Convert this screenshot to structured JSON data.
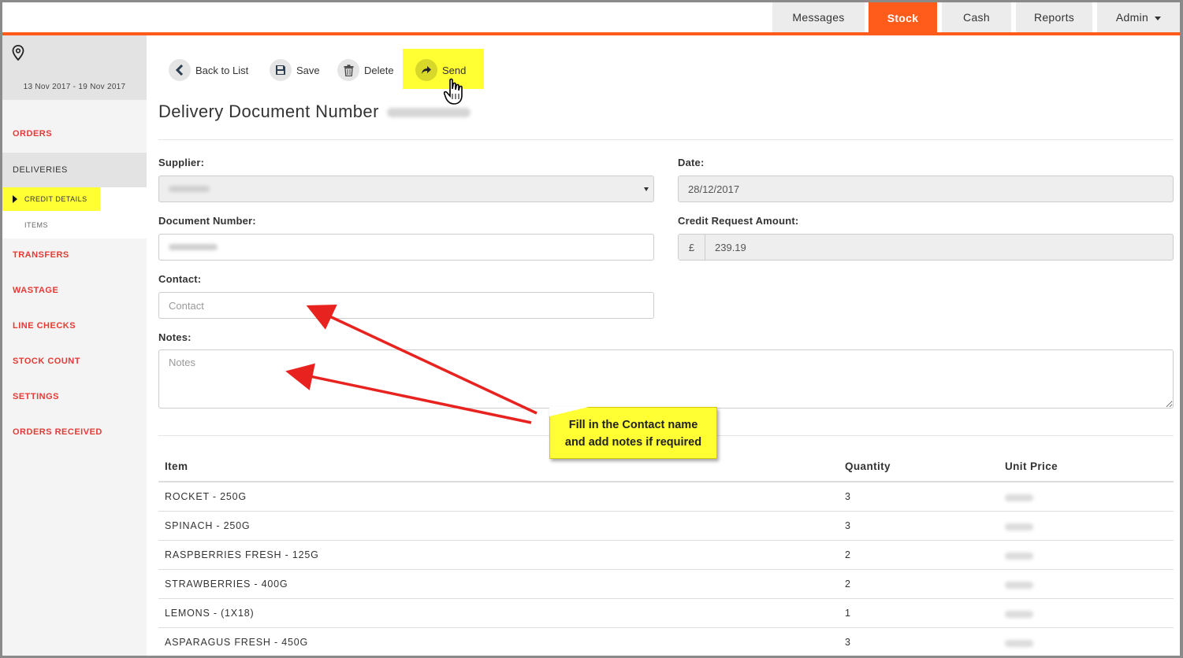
{
  "topnav": {
    "tabs": [
      {
        "label": "Messages",
        "active": false
      },
      {
        "label": "Stock",
        "active": true
      },
      {
        "label": "Cash",
        "active": false
      },
      {
        "label": "Reports",
        "active": false
      },
      {
        "label": "Admin",
        "active": false,
        "dropdown": true
      }
    ],
    "accent_color": "#ff5b1a"
  },
  "sidebar": {
    "location_icon": "map-pin-icon",
    "date_range": "13 Nov 2017 - 19 Nov 2017",
    "items": [
      {
        "label": "ORDERS",
        "active": false
      },
      {
        "label": "DELIVERIES",
        "active": true
      },
      {
        "label": "TRANSFERS",
        "active": false
      },
      {
        "label": "WASTAGE",
        "active": false
      },
      {
        "label": "LINE CHECKS",
        "active": false
      },
      {
        "label": "STOCK COUNT",
        "active": false
      },
      {
        "label": "SETTINGS",
        "active": false
      },
      {
        "label": "ORDERS RECEIVED",
        "active": false
      }
    ],
    "subitems": [
      {
        "label": "CREDIT DETAILS",
        "active": true
      },
      {
        "label": "ITEMS",
        "active": false
      }
    ]
  },
  "toolbar": {
    "back_label": "Back to List",
    "save_label": "Save",
    "delete_label": "Delete",
    "send_label": "Send"
  },
  "page": {
    "title": "Delivery Document Number"
  },
  "form": {
    "supplier_label": "Supplier:",
    "date_label": "Date:",
    "date_value": "28/12/2017",
    "document_number_label": "Document Number:",
    "credit_amount_label": "Credit Request Amount:",
    "currency_symbol": "£",
    "credit_amount_value": "239.19",
    "contact_label": "Contact:",
    "contact_placeholder": "Contact",
    "notes_label": "Notes:",
    "notes_placeholder": "Notes"
  },
  "callout": {
    "line1": "Fill in the Contact name",
    "line2": "and add notes if required",
    "color": "#ffff33"
  },
  "table": {
    "headers": {
      "item": "Item",
      "quantity": "Quantity",
      "unit_price": "Unit Price"
    },
    "rows": [
      {
        "item": "ROCKET - 250G",
        "quantity": "3"
      },
      {
        "item": "SPINACH - 250G",
        "quantity": "3"
      },
      {
        "item": "RASPBERRIES FRESH - 125G",
        "quantity": "2"
      },
      {
        "item": "STRAWBERRIES - 400G",
        "quantity": "2"
      },
      {
        "item": "LEMONS - (1X18)",
        "quantity": "1"
      },
      {
        "item": "ASPARAGUS FRESH - 450G",
        "quantity": "3"
      }
    ]
  }
}
